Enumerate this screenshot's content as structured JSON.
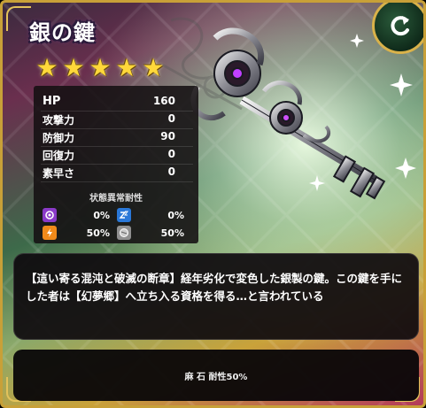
{
  "item": {
    "title": "銀の鍵",
    "stars": [
      "★",
      "★",
      "★",
      "★",
      "★"
    ]
  },
  "stats": [
    {
      "label": "HP",
      "value": "160"
    },
    {
      "label": "攻撃力",
      "value": "0"
    },
    {
      "label": "防御力",
      "value": "90"
    },
    {
      "label": "回復力",
      "value": "0"
    },
    {
      "label": "素早さ",
      "value": "0"
    }
  ],
  "resistances": {
    "title": "状態異常耐性",
    "items": [
      {
        "icon": "confusion-icon",
        "value": "0%",
        "color": "#8a3ac8"
      },
      {
        "icon": "sleep-icon",
        "value": "0%",
        "color": "#2a78d8"
      },
      {
        "icon": "paralysis-icon",
        "value": "50%",
        "color": "#f08a1a"
      },
      {
        "icon": "petrify-icon",
        "value": "50%",
        "color": "#909090"
      }
    ]
  },
  "description": "【這い寄る混沌と破滅の断章】経年劣化で変色した銀製の鍵。この鍵を手にした者は【幻夢郷】へ立ち入る資格を得る…と言われている",
  "effect": "麻 石 耐性50%",
  "colors": {
    "frame": "#c8a038",
    "star": "#ffd83a"
  }
}
